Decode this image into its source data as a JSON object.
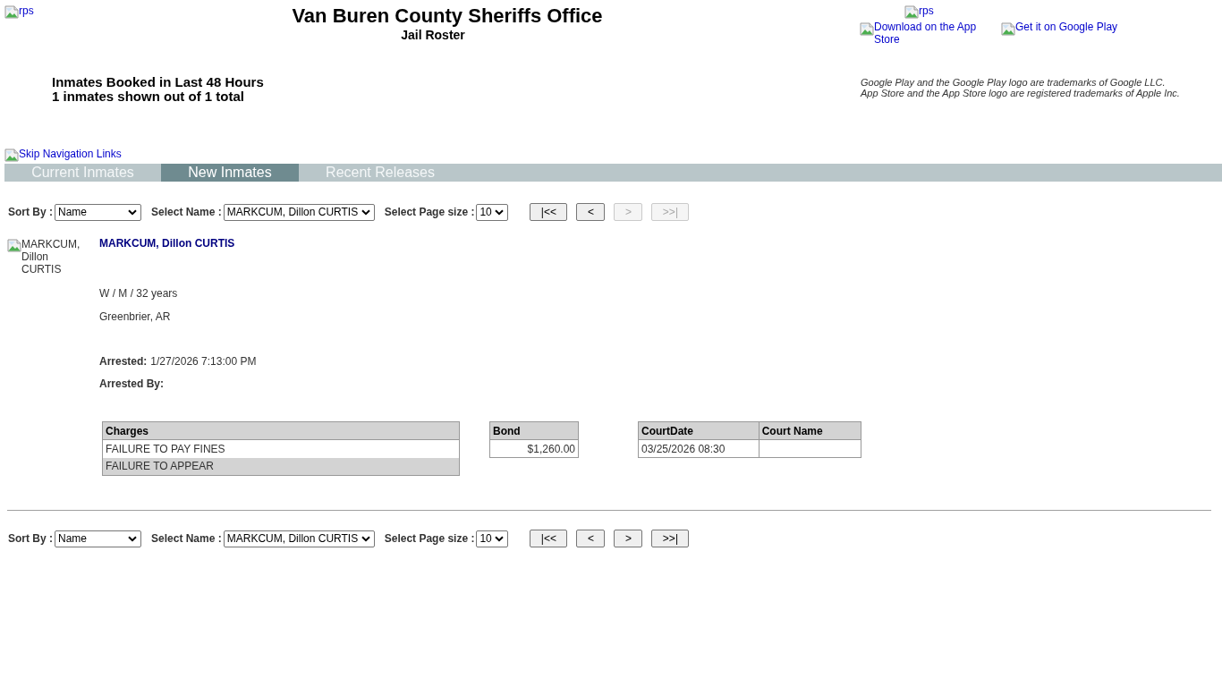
{
  "header": {
    "logo": {
      "alt": "rps"
    },
    "title": "Van Buren County Sheriffs Office",
    "subtitle": "Jail Roster",
    "summary": [
      "Inmates Booked in Last 48 Hours",
      "1 inmates shown out of 1 total"
    ]
  },
  "apps": {
    "logo": {
      "alt": "rps"
    },
    "links": [
      {
        "label": "Download on the App Store"
      },
      {
        "label": "Get it on Google Play"
      }
    ],
    "notices": [
      "Google Play and the Google Play logo are trademarks of Google LLC.",
      "App Store and the App Store logo are registered trademarks of Apple Inc."
    ]
  },
  "skip_link": "Skip Navigation Links",
  "tabs": [
    {
      "label": "Current Inmates",
      "selected": false
    },
    {
      "label": "New Inmates",
      "selected": true
    },
    {
      "label": "Recent Releases",
      "selected": false
    }
  ],
  "toolbars": [
    {
      "sort": {
        "label": "Sort By :",
        "value": "Name"
      },
      "name": {
        "label": "Select Name :",
        "value": "MARKCUM, Dillon CURTIS"
      },
      "page_size": {
        "label": "Select Page size :",
        "value": "10"
      },
      "buttons": [
        {
          "label": "|<<",
          "disabled": false
        },
        {
          "label": "<",
          "disabled": false
        },
        {
          "label": ">",
          "disabled": true
        },
        {
          "label": ">>|",
          "disabled": true
        }
      ]
    },
    {
      "sort": {
        "label": "Sort By :",
        "value": "Name"
      },
      "name": {
        "label": "Select Name :",
        "value": "MARKCUM, Dillon CURTIS"
      },
      "page_size": {
        "label": "Select Page size :",
        "value": "10"
      },
      "buttons": [
        {
          "label": "|<<",
          "disabled": false
        },
        {
          "label": "<",
          "disabled": false
        },
        {
          "label": ">",
          "disabled": false
        },
        {
          "label": ">>|",
          "disabled": false
        }
      ]
    }
  ],
  "inmate": {
    "photo_alt": "MARKCUM, Dillon CURTIS",
    "name": "MARKCUM, Dillon CURTIS",
    "demographics": "W / M / 32 years",
    "location": "Greenbrier, AR",
    "fields": [
      {
        "label": "Arrested:",
        "value": "1/27/2026 7:13:00 PM"
      },
      {
        "label": "Arrested By:"
      }
    ],
    "tables": [
      {
        "kind": "charges",
        "columns": [
          "Charges"
        ],
        "rows": [
          [
            "FAILURE TO PAY FINES"
          ],
          [
            "FAILURE TO APPEAR"
          ]
        ]
      },
      {
        "kind": "bond",
        "columns": [
          "Bond"
        ],
        "rows": [
          [
            "$1,260.00"
          ]
        ]
      },
      {
        "kind": "court",
        "columns": [
          "CourtDate",
          "Court Name"
        ],
        "rows": [
          [
            "03/25/2026 08:30"
          ]
        ]
      }
    ]
  }
}
